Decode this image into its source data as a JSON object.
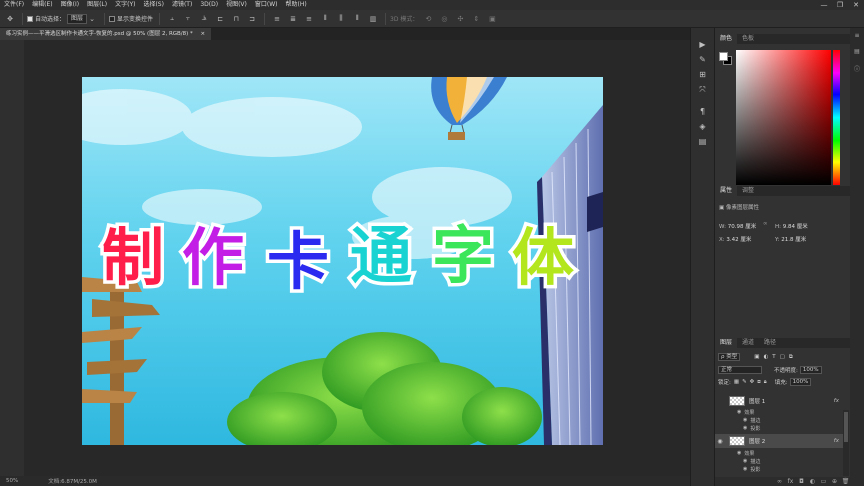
{
  "menu": [
    "文件(F)",
    "编辑(E)",
    "图像(I)",
    "图层(L)",
    "文字(Y)",
    "选择(S)",
    "滤镜(T)",
    "3D(D)",
    "视图(V)",
    "窗口(W)",
    "帮助(H)"
  ],
  "window_controls": {
    "minimize": "—",
    "restore": "❐",
    "close": "✕"
  },
  "options": {
    "auto_select_label": "自动选择：",
    "auto_select_target": "图层",
    "show_transform_label": "显示变换控件",
    "mode_3d_label": "3D 模式："
  },
  "document_tab": "练习实例——平滑选区制作卡通文字-恢复的.psd @ 50% (图层 2, RGB/8) *",
  "status": {
    "zoom": "50%",
    "doc_size": "文档:6.87M/25.0M"
  },
  "color_panel": {
    "tabs": [
      "颜色",
      "色板"
    ],
    "fg": "#ffffff",
    "bg": "#000000"
  },
  "properties_panel": {
    "tabs": [
      "属性",
      "调整"
    ],
    "title": "像素图层属性",
    "w_label": "W:",
    "w_value": "70.98 厘米",
    "h_label": "H:",
    "h_value": "9.84 厘米",
    "x_label": "X:",
    "x_value": "3.42 厘米",
    "y_label": "Y:",
    "y_value": "21.8 厘米",
    "link_icon": "∞"
  },
  "layers_panel": {
    "tabs": [
      "图层",
      "通道",
      "路径"
    ],
    "filter_kind": "ρ 类型",
    "blend_mode": "正常",
    "opacity_label": "不透明度:",
    "opacity_value": "100%",
    "lock_label": "锁定:",
    "fill_label": "填充:",
    "fill_value": "100%",
    "layers": [
      {
        "name": "图层 1",
        "fx": "fx",
        "effects_label": "效果",
        "effects": [
          "描边",
          "投影"
        ],
        "visible": false
      },
      {
        "name": "图层 2",
        "fx": "fx",
        "effects_label": "效果",
        "effects": [
          "描边",
          "投影"
        ],
        "visible": true,
        "selected": true
      }
    ]
  },
  "canvas": {
    "artwork_text": [
      "制",
      "作",
      "卡",
      "通",
      "字",
      "体"
    ],
    "artwork_colors": [
      "#ff1e4a",
      "#c21ee6",
      "#2a2af0",
      "#19d3d3",
      "#3ce65a",
      "#b4e61e"
    ],
    "sky_color": "#58cdea"
  }
}
